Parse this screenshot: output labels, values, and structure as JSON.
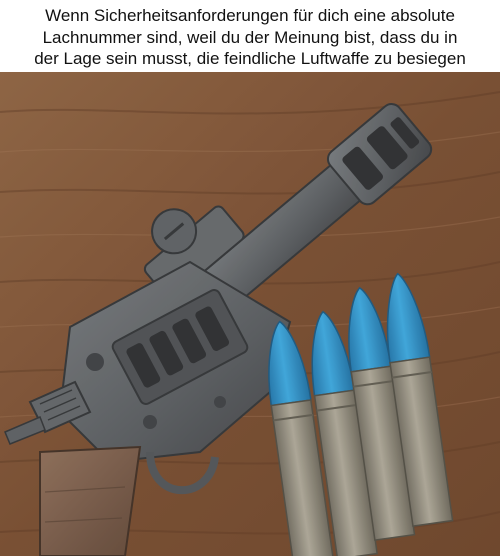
{
  "caption": {
    "lines": [
      "Wenn Sicherheitsanforderungen für dich eine absolute",
      "Lachnummer sind, weil du der Meinung bist, dass du in",
      "der Lage sein musst, die feindliche Luftwaffe zu besiegen"
    ]
  },
  "photo": {
    "subject": "makeshift revolver with muzzle brake and scope rail",
    "bullet_count": 4,
    "colors": {
      "table": "#7a5234",
      "metal": "#5c5f62",
      "bullet_tip": "#2e8fc4",
      "casing": "#8f8a7c"
    }
  }
}
